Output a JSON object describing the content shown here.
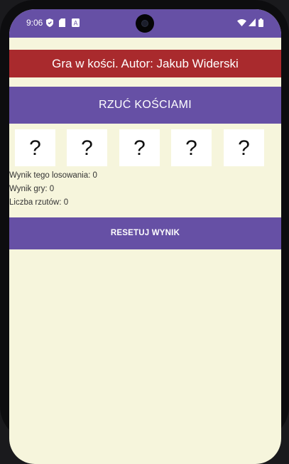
{
  "status_bar": {
    "time": "9:06",
    "left_icons": [
      "shield-icon",
      "sd-card-icon",
      "keyboard-icon"
    ],
    "right_icons": [
      "wifi-icon",
      "signal-icon",
      "battery-icon"
    ]
  },
  "app": {
    "title": "Gra w kości. Autor: Jakub Widerski",
    "roll_button_label": "RZUĆ KOŚCIAMI",
    "dice": [
      "?",
      "?",
      "?",
      "?",
      "?"
    ],
    "roll_result": "Wynik tego losowania: 0",
    "game_score": "Wynik gry: 0",
    "roll_count": "Liczba rzutów: 0",
    "reset_button_label": "RESETUJ WYNIK"
  },
  "colors": {
    "accent": "#6650a5",
    "title_bar": "#a92a2d",
    "background": "#f6f5dc"
  }
}
